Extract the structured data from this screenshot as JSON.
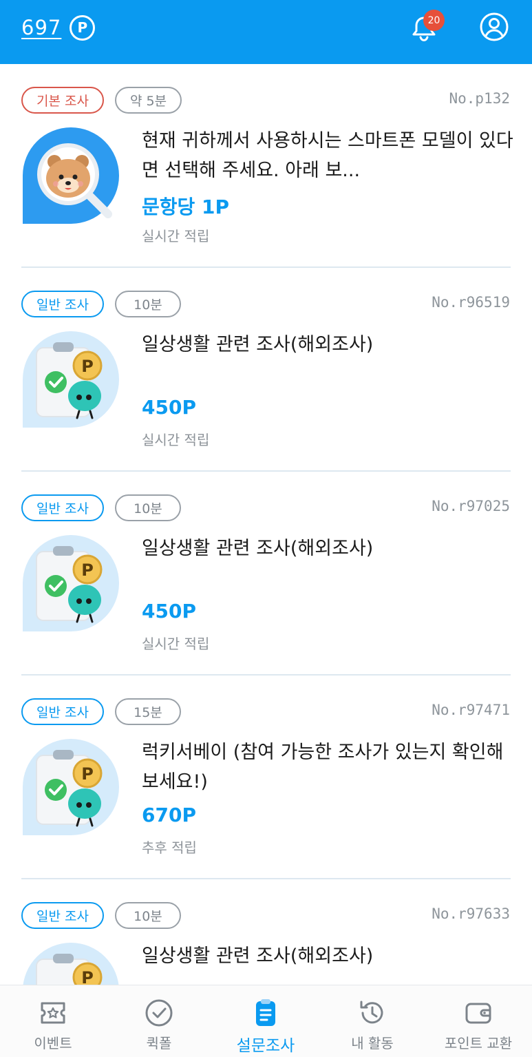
{
  "header": {
    "points": "697",
    "points_icon": "P",
    "notification_count": "20"
  },
  "surveys": [
    {
      "category": "기본 조사",
      "category_type": "basic",
      "duration": "약 5분",
      "id": "No.p132",
      "title": "현재 귀하께서 사용하시는 스마트폰 모델이 있다면 선택해 주세요. 아래 보...",
      "reward": "문항당 1P",
      "accrual": "실시간 적립",
      "thumb": "magnifier-bear"
    },
    {
      "category": "일반 조사",
      "category_type": "general",
      "duration": "10분",
      "id": "No.r96519",
      "title": "일상생활 관련 조사(해외조사)",
      "reward": "450P",
      "accrual": "실시간 적립",
      "thumb": "clipboard-coin"
    },
    {
      "category": "일반 조사",
      "category_type": "general",
      "duration": "10분",
      "id": "No.r97025",
      "title": "일상생활 관련 조사(해외조사)",
      "reward": "450P",
      "accrual": "실시간 적립",
      "thumb": "clipboard-coin"
    },
    {
      "category": "일반 조사",
      "category_type": "general",
      "duration": "15분",
      "id": "No.r97471",
      "title": "럭키서베이 (참여 가능한 조사가 있는지 확인해보세요!)",
      "reward": "670P",
      "accrual": "추후 적립",
      "thumb": "clipboard-coin"
    },
    {
      "category": "일반 조사",
      "category_type": "general",
      "duration": "10분",
      "id": "No.r97633",
      "title": "일상생활 관련 조사(해외조사)",
      "reward": "",
      "accrual": "",
      "thumb": "clipboard-coin"
    }
  ],
  "nav": [
    {
      "label": "이벤트",
      "icon": "ticket-icon",
      "active": false
    },
    {
      "label": "퀵폴",
      "icon": "check-circle-icon",
      "active": false
    },
    {
      "label": "설문조사",
      "icon": "clipboard-icon",
      "active": true
    },
    {
      "label": "내 활동",
      "icon": "history-icon",
      "active": false
    },
    {
      "label": "포인트 교환",
      "icon": "wallet-icon",
      "active": false
    }
  ],
  "colors": {
    "primary": "#0a9af0",
    "basic_tag": "#d9564a",
    "badge": "#e6503a",
    "muted": "#8d9399"
  }
}
